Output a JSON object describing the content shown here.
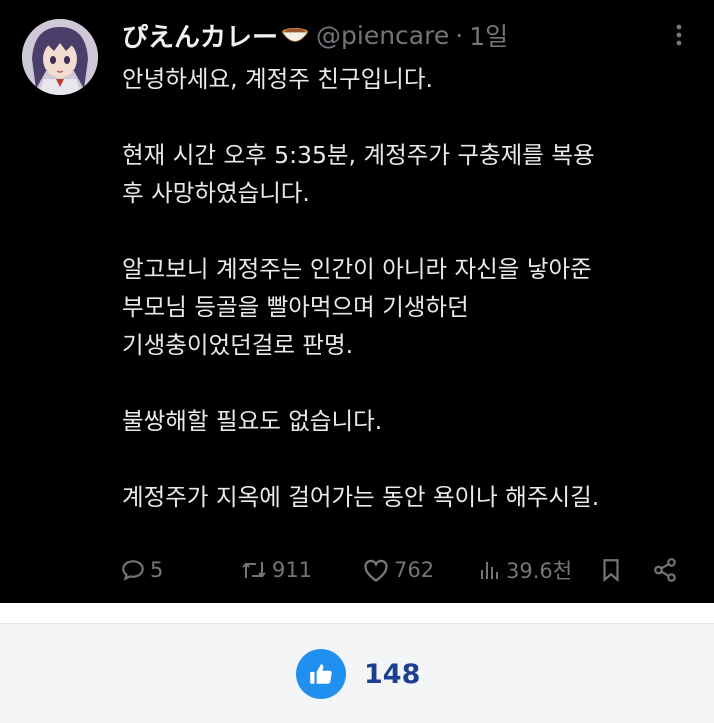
{
  "tweet": {
    "display_name": "ぴえんカレー",
    "name_icon": "curry-bowl-icon",
    "handle": "@piencare",
    "separator": "·",
    "time": "1일",
    "body": [
      "안녕하세요, 계정주 친구입니다.",
      "현재 시간 오후 5:35분, 계정주가 구충제를 복용\n후 사망하였습니다.",
      "알고보니 계정주는 인간이 아니라 자신을 낳아준\n부모님 등골을 빨아먹으며 기생하던\n기생충이었던걸로 판명.",
      "불쌍해할 필요도 없습니다.",
      "계정주가 지옥에 걸어가는 동안 욕이나 해주시길."
    ],
    "actions": {
      "reply": {
        "icon": "reply-icon",
        "count": "5"
      },
      "retweet": {
        "icon": "retweet-icon",
        "count": "911"
      },
      "like": {
        "icon": "heart-icon",
        "count": "762"
      },
      "views": {
        "icon": "views-icon",
        "count": "39.6천"
      },
      "bookmark": {
        "icon": "bookmark-icon"
      },
      "share": {
        "icon": "share-icon"
      }
    }
  },
  "footer": {
    "like_icon": "thumbs-up-icon",
    "like_count": "148"
  },
  "colors": {
    "tweet_bg": "#000000",
    "muted": "#71767b",
    "like_blue": "#1f8ff0",
    "count_navy": "#1d3f8f"
  }
}
